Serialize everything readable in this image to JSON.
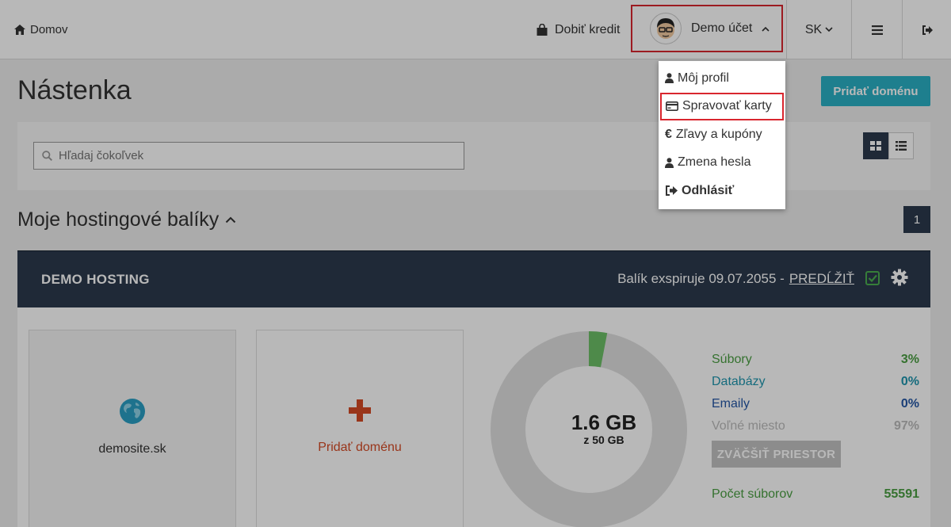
{
  "topbar": {
    "home_label": "Domov",
    "credit_label": "Dobiť kredit",
    "account_label": "Demo účet",
    "language_label": "SK"
  },
  "account_menu": {
    "items": [
      {
        "label": "Môj profil",
        "icon": "user-icon"
      },
      {
        "label": "Spravovať karty",
        "icon": "credit-card-icon"
      },
      {
        "label": "Zľavy a kupóny",
        "icon": "euro-icon"
      },
      {
        "label": "Zmena hesla",
        "icon": "user-icon"
      },
      {
        "label": "Odhlásiť",
        "icon": "sign-out-icon"
      }
    ]
  },
  "page": {
    "title": "Nástenka",
    "add_domain_button": "Pridať doménu",
    "search_placeholder": "Hľadaj čokoľvek",
    "section_title": "Moje hostingové balíky",
    "page_number": "1"
  },
  "package": {
    "name": "DEMO HOSTING",
    "expiry_text": "Balík exspiruje 09.07.2055 -",
    "renew_link": "PREDĹŽIŤ",
    "domain_card_label": "demosite.sk",
    "add_domain_card_label": "Pridať doménu",
    "usage_main": "1.6 GB",
    "usage_sub": "z 50 GB",
    "used_fraction": 0.03,
    "stats": [
      {
        "label": "Súbory",
        "value": "3%"
      },
      {
        "label": "Databázy",
        "value": "0%"
      },
      {
        "label": "Emaily",
        "value": "0%"
      },
      {
        "label": "Voľné miesto",
        "value": "97%"
      }
    ],
    "enlarge_button": "ZVÄČŠIŤ PRIESTOR",
    "file_count_label": "Počet súborov",
    "file_count_value": "55591"
  },
  "colors": {
    "accent": "#2ab0c5",
    "header_dark": "#2b3a4d",
    "highlight": "#d9262e",
    "files_green": "#4a9e42"
  }
}
